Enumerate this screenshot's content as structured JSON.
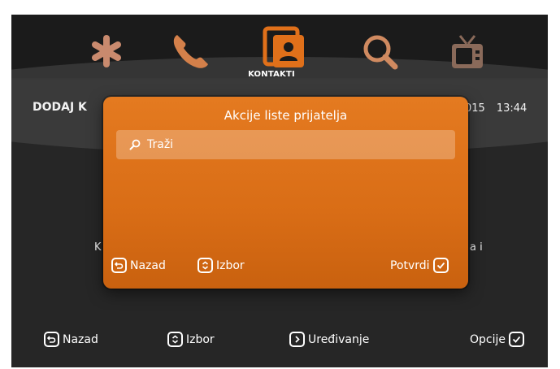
{
  "app_title": "KONTAKTI",
  "header": {
    "left_label": "DODAJ K",
    "date_fragment": "015",
    "time": "13:44"
  },
  "background_fragments": {
    "left": "K",
    "right": "a i"
  },
  "dialog": {
    "title": "Akcije liste prijatelja",
    "items": [
      {
        "label": "Traži",
        "icon": "search-icon"
      }
    ],
    "footer": {
      "back": "Nazad",
      "select": "Izbor",
      "confirm": "Potvrdi"
    }
  },
  "bottom_bar": {
    "back": "Nazad",
    "select": "Izbor",
    "edit": "Uređivanje",
    "options": "Opcije"
  },
  "top_icons": [
    "asterisk-icon",
    "phone-icon",
    "contacts-icon",
    "search-icon",
    "tv-icon"
  ],
  "colors": {
    "accent": "#e47a20",
    "icon_dim": "#c07a5a",
    "background": "#222222"
  }
}
